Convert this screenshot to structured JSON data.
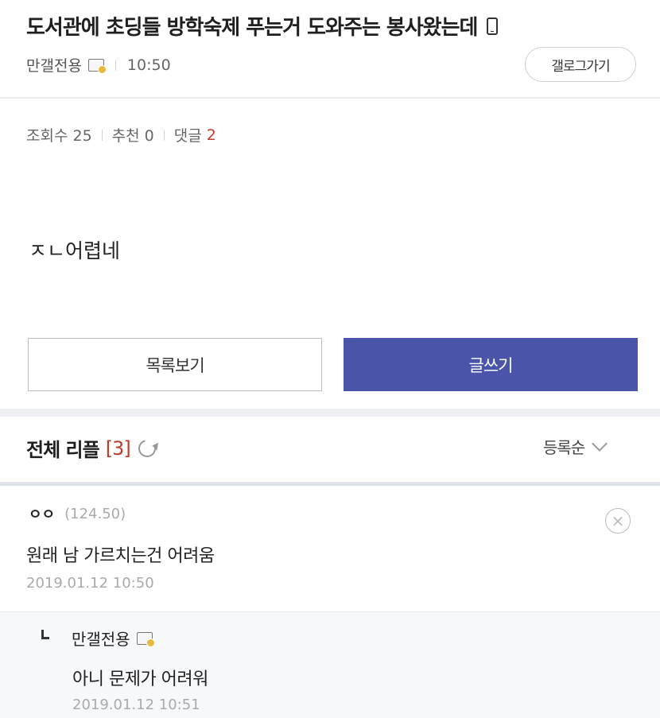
{
  "post": {
    "title": "도서관에 초딩들 방학숙제 푸는거 도와주는 봉사왔는데",
    "author": "만갤전용",
    "time": "10:50",
    "gallery_button": "갤로그가기",
    "views_label": "조회수 25",
    "recommend_label": "추천 0",
    "comments_label": "댓글",
    "comments_count": "2",
    "body": "ㅈㄴ어렵네"
  },
  "buttons": {
    "list_label": "목록보기",
    "write_label": "글쓰기"
  },
  "replies": {
    "header": "전체 리플",
    "count": "[3]",
    "sort_label": "등록순",
    "items": [
      {
        "author": "ㅇㅇ",
        "ip": "(124.50)",
        "text": "원래 남 가르치는건 어려움",
        "date": "2019.01.12 10:50"
      },
      {
        "author": "만갤전용",
        "text": "아니 문제가 어려워",
        "date": "2019.01.12 10:51"
      }
    ]
  },
  "colors": {
    "accent": "#4a55a9",
    "highlight_red": "#c0392b"
  },
  "icons": [
    "mobile-icon",
    "fixed-nick-icon",
    "refresh-icon",
    "chevron-down-icon",
    "delete-icon",
    "reply-marker-icon"
  ]
}
